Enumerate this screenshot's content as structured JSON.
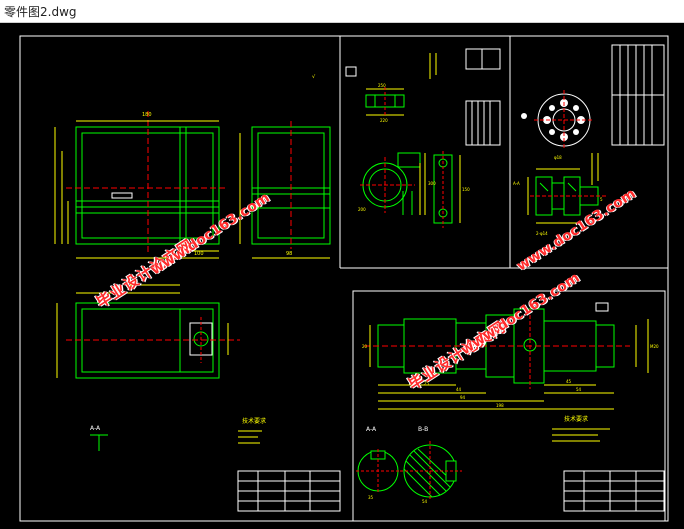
{
  "window": {
    "title": "零件图2.dwg"
  },
  "colors": {
    "background": "#000000",
    "border": "#ffffff",
    "geometry": "#00ff00",
    "dimension": "#ffff00",
    "centerline": "#ff0000",
    "titleblock": "#ffffff",
    "watermark": "#ff2b2b"
  },
  "watermarks": [
    {
      "cn": "毕业设计论文网",
      "url": "www.doc163.com"
    },
    {
      "cn": "毕业设计论文网",
      "url": "www.doc163.com"
    },
    {
      "cn": "毕业设计论文网",
      "url": "www.doc163.com"
    }
  ],
  "sheet1": {
    "section_label": "A-A",
    "note_title": "技术要求",
    "dims": {
      "a": "100",
      "b": "98",
      "c": "180"
    }
  },
  "sheet2": {
    "dims": {
      "d1": "250",
      "d2": "220",
      "d3": "200",
      "d4": "300",
      "d5": "150"
    }
  },
  "sheet3": {
    "section_label": "A-A",
    "dims": {
      "e1": "2-φ14",
      "e2": "φ18",
      "e3": "5"
    }
  },
  "sheet4": {
    "section_a": "A-A",
    "section_b": "B-B",
    "note_title": "技术要求",
    "dims": {
      "f1": "25",
      "f2": "44",
      "f3": "94",
      "f4": "198",
      "f5": "45",
      "f6": "54",
      "f7": "M20",
      "f8": "20",
      "f9": "35",
      "f10": "54"
    }
  }
}
